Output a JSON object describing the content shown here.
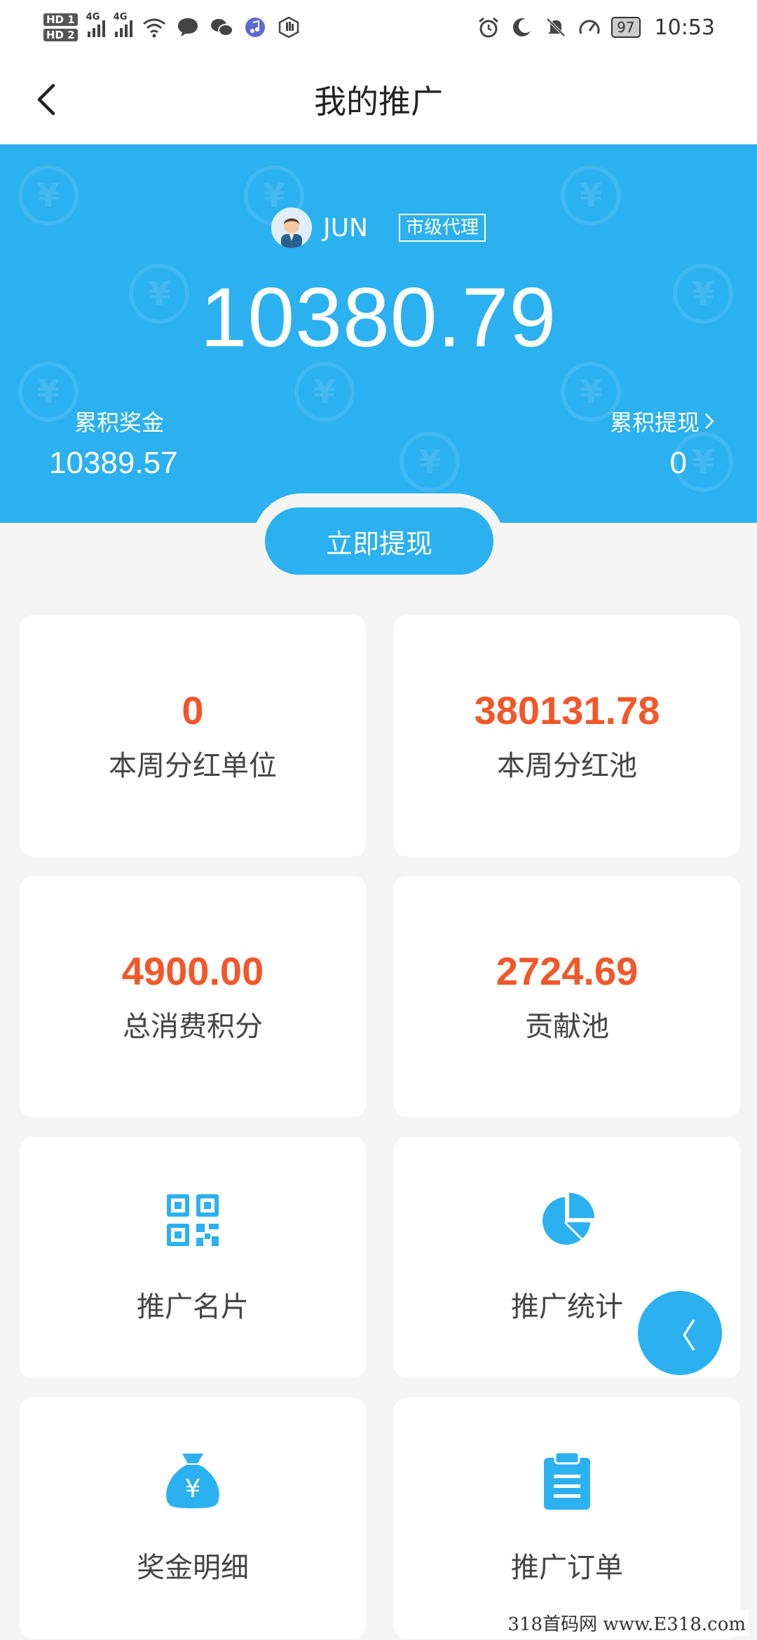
{
  "status_bar": {
    "hd1": "HD 1",
    "hd2": "HD 2",
    "net1": "4G",
    "net2": "4G",
    "battery": "97",
    "time": "10:53"
  },
  "nav": {
    "title": "我的推广",
    "back_icon": "chevron-left-icon"
  },
  "hero": {
    "username": "JUN",
    "level": "市级代理",
    "balance": "10380.79",
    "accumulated_bonus_label": "累积奖金",
    "accumulated_bonus_value": "10389.57",
    "accumulated_withdraw_label": "累积提现",
    "accumulated_withdraw_value": "0",
    "bg_color": "#2bb0f0"
  },
  "withdraw_button": "立即提现",
  "stats": [
    {
      "value": "0",
      "label": "本周分红单位"
    },
    {
      "value": "380131.78",
      "label": "本周分红池"
    },
    {
      "value": "4900.00",
      "label": "总消费积分"
    },
    {
      "value": "2724.69",
      "label": "贡献池"
    }
  ],
  "menu": [
    {
      "label": "推广名片",
      "icon": "qr-code-icon"
    },
    {
      "label": "推广统计",
      "icon": "pie-chart-icon"
    },
    {
      "label": "奖金明细",
      "icon": "money-bag-icon"
    },
    {
      "label": "推广订单",
      "icon": "clipboard-icon"
    }
  ],
  "float_button": "〈",
  "watermark": "318首码网 www.E318.com",
  "colors": {
    "accent": "#2bb0f0",
    "number": "#f2572a",
    "background": "#f5f5f5"
  }
}
